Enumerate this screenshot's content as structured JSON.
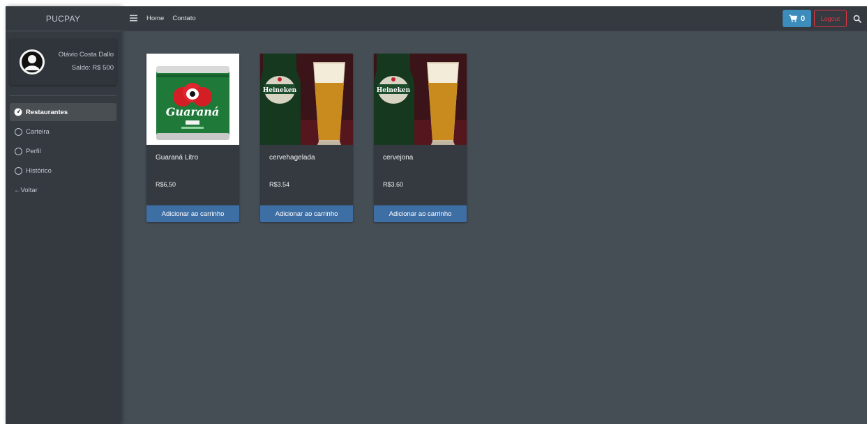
{
  "brand": "PUCPAY",
  "user": {
    "name": "Otávio Costa Dallo",
    "balance": "Saldo: R$ 500"
  },
  "nav": {
    "items": [
      {
        "label": "Restaurantes",
        "icon": "tachometer-icon",
        "active": true
      },
      {
        "label": "Carteira",
        "icon": "circle-icon"
      },
      {
        "label": "Perfil",
        "icon": "circle-icon"
      },
      {
        "label": "Histórico",
        "icon": "circle-icon"
      }
    ],
    "back_label": "←Voltar"
  },
  "topbar": {
    "menu_icon": "hamburger-icon",
    "links": [
      "Home",
      "Contato"
    ],
    "cart_count": "0",
    "logout_label": "Logout",
    "search_icon": "search-icon"
  },
  "products": [
    {
      "name": "Guaraná Litro",
      "price": "R$6,50",
      "image": "guarana-can",
      "button": "Adicionar ao carrinho",
      "can_label": "Guaraná"
    },
    {
      "name": "cervehagelada",
      "price": "R$3.54",
      "image": "heineken-beer",
      "button": "Adicionar ao carrinho",
      "bottle_label": "Heineken"
    },
    {
      "name": "cervejona",
      "price": "R$3.60",
      "image": "heineken-beer",
      "button": "Adicionar ao carrinho",
      "bottle_label": "Heineken"
    }
  ],
  "colors": {
    "sidebar": "#343a40",
    "content_bg": "#454d55",
    "primary": "#3c8dbc",
    "danger": "#dc3545",
    "card_button": "#3d6fa5"
  }
}
